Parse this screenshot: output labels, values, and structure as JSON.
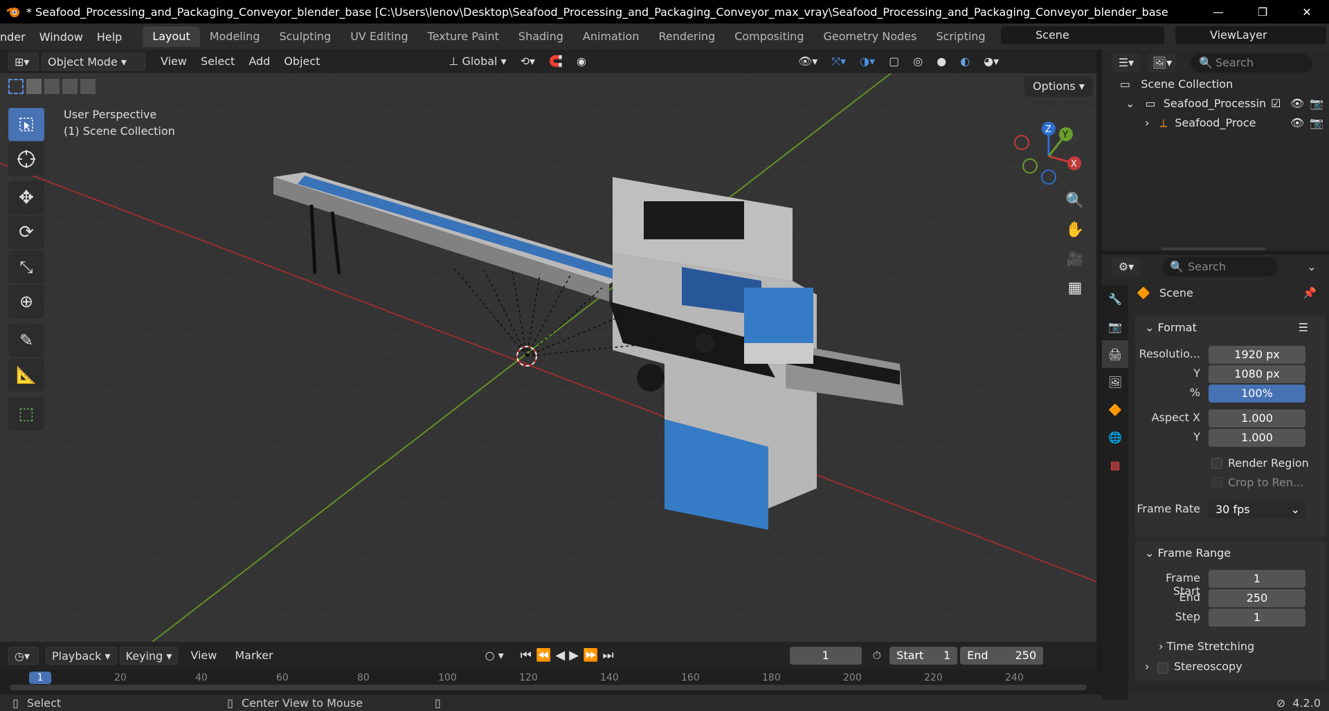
{
  "window": {
    "title": "* Seafood_Processing_and_Packaging_Conveyor_blender_base [C:\\Users\\lenov\\Desktop\\Seafood_Processing_and_Packaging_Conveyor_max_vray\\Seafood_Processing_and_Packaging_Conveyor_blender_base.blend] - Blender ...",
    "minimize": "—",
    "maximize": "❐",
    "close": "✕"
  },
  "menubar": {
    "items": [
      "nder",
      "Window",
      "Help"
    ]
  },
  "workspaces": {
    "tabs": [
      "Layout",
      "Modeling",
      "Sculpting",
      "UV Editing",
      "Texture Paint",
      "Shading",
      "Animation",
      "Rendering",
      "Compositing",
      "Geometry Nodes",
      "Scripting"
    ],
    "active": "Layout",
    "add": "+"
  },
  "scene": {
    "name": "Scene",
    "view_layer": "ViewLayer"
  },
  "viewport_header": {
    "mode": "Object Mode",
    "menus": [
      "View",
      "Select",
      "Add",
      "Object"
    ],
    "transform_orientation": "Global",
    "options": "Options"
  },
  "viewport": {
    "perspective": "User Perspective",
    "collection": "(1) Scene Collection",
    "gizmo": {
      "z": "Z",
      "y": "Y",
      "x": "X"
    }
  },
  "outliner": {
    "search_placeholder": "Search",
    "root": "Scene Collection",
    "items": [
      {
        "label": "Seafood_Processin",
        "level": 1
      },
      {
        "label": "Seafood_Proce",
        "level": 2
      }
    ]
  },
  "properties": {
    "search_placeholder": "Search",
    "context": "Scene",
    "format": {
      "title": "Format",
      "resolution_label": "Resolutio...",
      "res_x": "1920 px",
      "y_label": "Y",
      "res_y": "1080 px",
      "pct_label": "%",
      "pct": "100%",
      "aspect_x_label": "Aspect X",
      "aspect_x": "1.000",
      "aspect_y_label": "Y",
      "aspect_y": "1.000",
      "render_region": "Render Region",
      "crop": "Crop to Ren...",
      "frame_rate_label": "Frame Rate",
      "frame_rate": "30 fps"
    },
    "frame_range": {
      "title": "Frame Range",
      "start_label": "Frame Start",
      "start": "1",
      "end_label": "End",
      "end": "250",
      "step_label": "Step",
      "step": "1"
    },
    "time_stretching": "Time Stretching",
    "stereoscopy": "Stereoscopy"
  },
  "timeline": {
    "menus": [
      "Playback",
      "Keying",
      "View",
      "Marker"
    ],
    "current_frame": "1",
    "start_label": "Start",
    "start": "1",
    "end_label": "End",
    "end": "250",
    "ticks": [
      "1",
      "20",
      "40",
      "60",
      "80",
      "100",
      "120",
      "140",
      "160",
      "180",
      "200",
      "220",
      "240"
    ]
  },
  "statusbar": {
    "select": "Select",
    "center": "Center View to Mouse",
    "version": "4.2.0"
  }
}
